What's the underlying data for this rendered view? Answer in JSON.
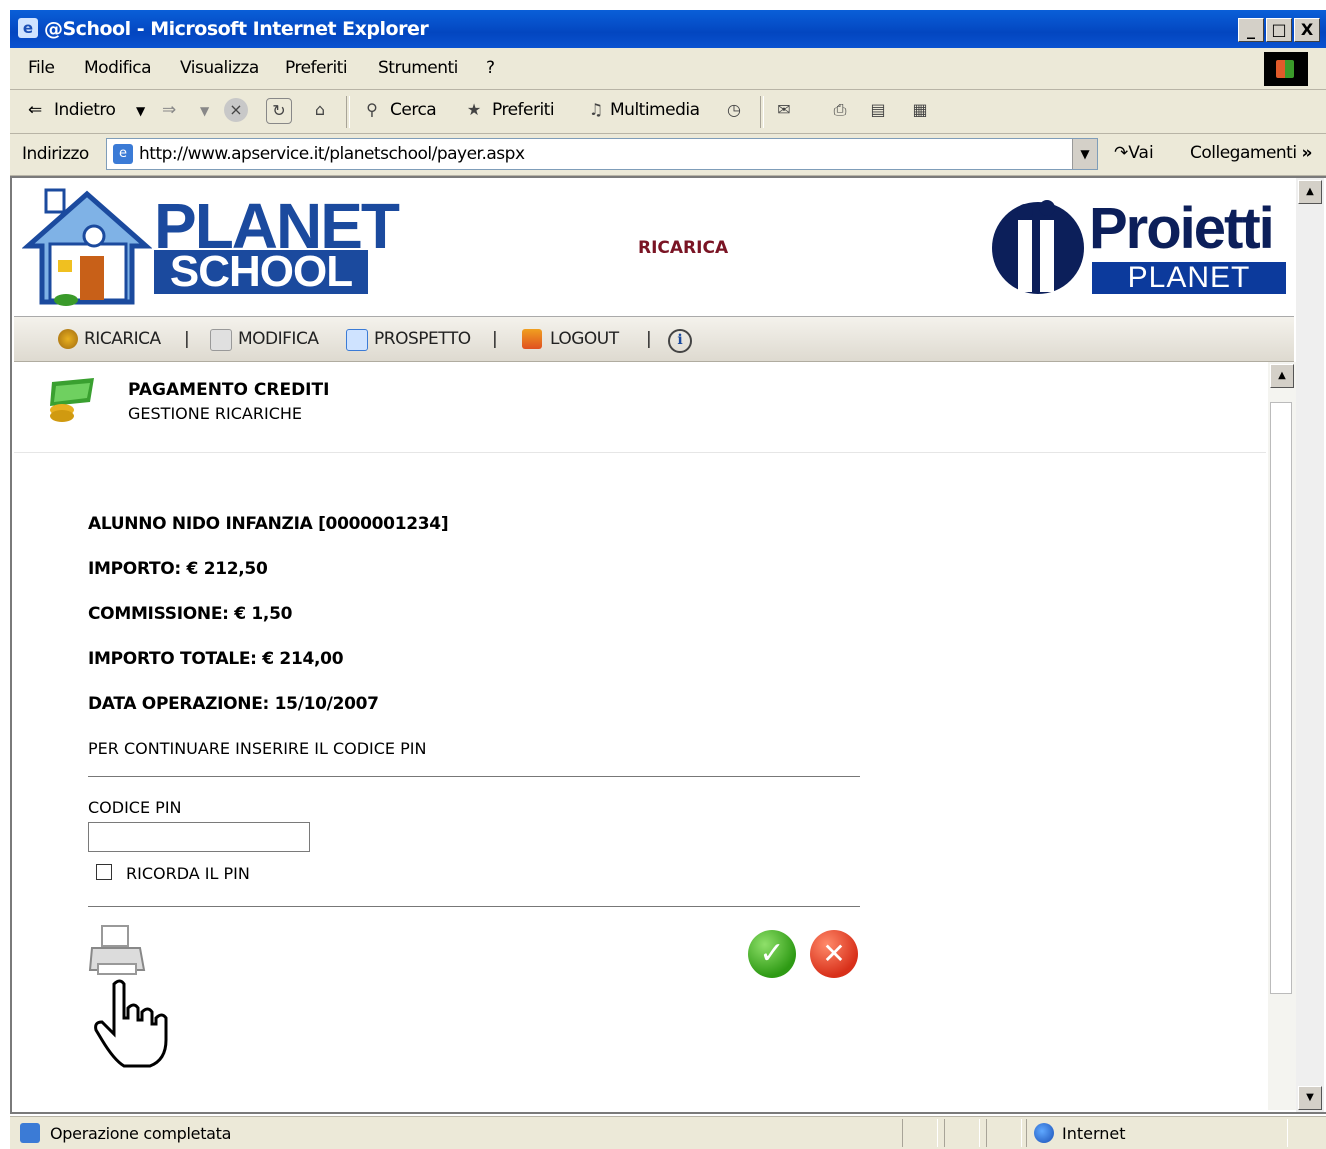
{
  "window": {
    "title": "@School - Microsoft Internet Explorer",
    "buttons": [
      "_",
      "□",
      "X"
    ]
  },
  "menu": [
    "File",
    "Modifica",
    "Visualizza",
    "Preferiti",
    "Strumenti",
    "?"
  ],
  "toolbar": {
    "back_label": "Indietro",
    "search_label": "Cerca",
    "favorites_label": "Preferiti",
    "media_label": "Multimedia"
  },
  "address": {
    "label": "Indirizzo",
    "url": "http://www.apservice.it/planetschool/payer.aspx",
    "go_label": "Vai",
    "links_label": "Collegamenti"
  },
  "header": {
    "logo_top": "PLANET",
    "logo_bottom": "SCHOOL",
    "title": "RICARICA",
    "brand_top": "Proietti",
    "brand_bottom": "PLANET"
  },
  "nav": {
    "ricarica": "RICARICA",
    "modifica": "MODIFICA",
    "prospetto": "PROSPETTO",
    "logout": "LOGOUT",
    "separator": "|"
  },
  "section": {
    "title": "PAGAMENTO CREDITI",
    "subtitle": "GESTIONE RICARICHE"
  },
  "details": {
    "student": "ALUNNO NIDO INFANZIA [0000001234]",
    "amount": "IMPORTO: € 212,50",
    "commission": "COMMISSIONE: € 1,50",
    "total": "IMPORTO TOTALE: € 214,00",
    "date": "DATA OPERAZIONE: 15/10/2007",
    "instruction": "PER CONTINUARE INSERIRE IL CODICE PIN"
  },
  "form": {
    "pin_label": "CODICE PIN",
    "pin_value": "",
    "remember_label": "RICORDA IL PIN",
    "remember_checked": false
  },
  "status": {
    "text": "Operazione completata",
    "zone": "Internet"
  },
  "colors": {
    "accent": "#7a1424",
    "brand": "#1b4a9e",
    "titlebar": "#0346c0"
  }
}
